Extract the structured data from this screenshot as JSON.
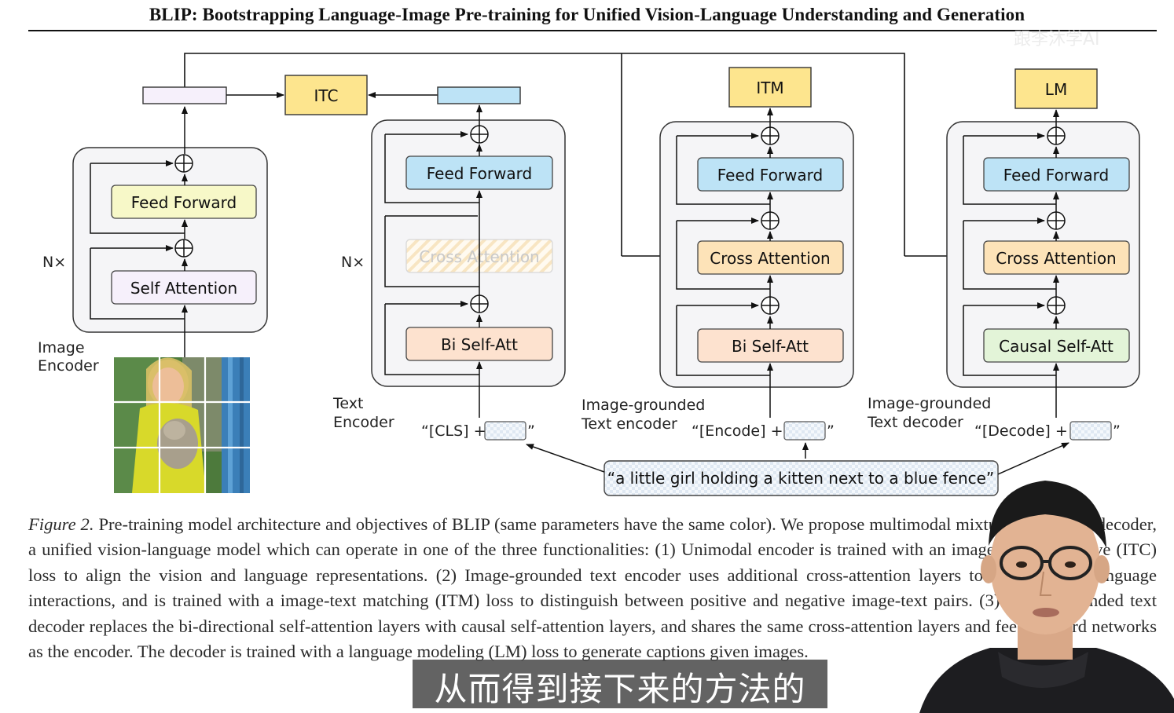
{
  "paper": {
    "title": "BLIP: Bootstrapping Language-Image Pre-training for Unified Vision-Language Understanding and Generation",
    "watermark": "跟李沐学AI"
  },
  "diagram": {
    "repeat_label": "N×",
    "image_encoder": {
      "label_line1": "Image",
      "label_line2": "Encoder",
      "layers": [
        "Feed Forward",
        "Self Attention"
      ]
    },
    "text_encoder": {
      "label_line1": "Text",
      "label_line2": "Encoder",
      "layers": [
        "Feed Forward",
        "Cross Attention",
        "Bi Self-Att"
      ],
      "input_token": "“[CLS] +",
      "input_close": "”"
    },
    "grounded_encoder": {
      "label_line1": "Image-grounded",
      "label_line2": "Text encoder",
      "layers": [
        "Feed Forward",
        "Cross Attention",
        "Bi Self-Att"
      ],
      "input_token": "“[Encode] +",
      "input_close": "”"
    },
    "grounded_decoder": {
      "label_line1": "Image-grounded",
      "label_line2": "Text decoder",
      "layers": [
        "Feed Forward",
        "Cross Attention",
        "Causal Self-Att"
      ],
      "input_token": "“[Decode] +",
      "input_close": "”"
    },
    "objectives": [
      "ITC",
      "ITM",
      "LM"
    ],
    "input_sentence": "“a little girl holding a kitten next to a blue fence”",
    "colors": {
      "feed_forward_image": "#f7f8c8",
      "self_attention": "#f6f0fb",
      "feed_forward_text": "#bde3f6",
      "cross_attention": "#fde3b8",
      "bi_self_att": "#fde2cf",
      "causal_self_att": "#e3f4d8",
      "objective": "#fde58e",
      "module_bg": "#f5f5f7"
    }
  },
  "caption": {
    "figure_label": "Figure 2.",
    "text": "Pre-training model architecture and objectives of BLIP (same parameters have the same color). We propose multimodal mixture of encoder-decoder, a unified vision-language model which can operate in one of the three functionalities: (1) Unimodal encoder is trained with an image-text contrastive (ITC) loss to align the vision and language representations. (2) Image-grounded text encoder uses additional cross-attention layers to model vision-language interactions, and is trained with a image-text matching (ITM) loss to distinguish between positive and negative image-text pairs. (3) Image-grounded text decoder replaces the bi-directional self-attention layers with causal self-attention layers, and shares the same cross-attention layers and feed forward networks as the encoder. The decoder is trained with a language modeling (LM) loss to generate captions given images."
  },
  "subtitle": "从而得到接下来的方法的"
}
